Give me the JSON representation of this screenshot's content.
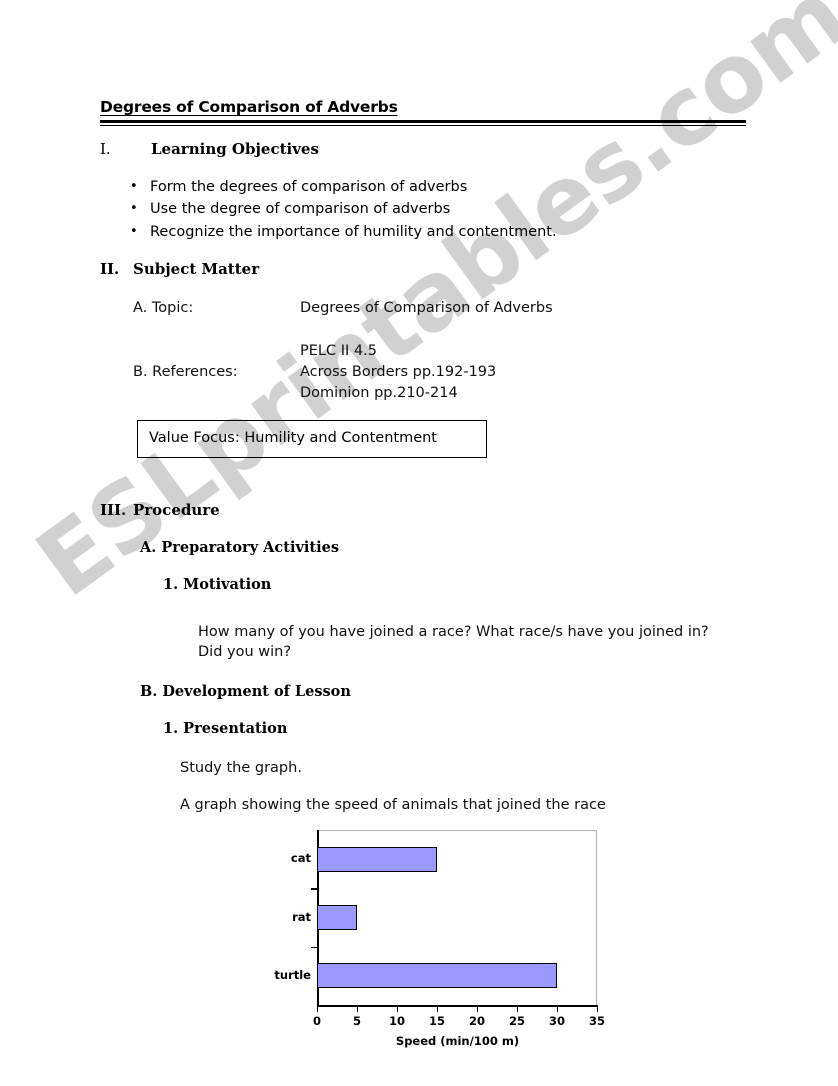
{
  "watermark": {
    "text": "ESLprintables.com",
    "color": "#c9c9c9"
  },
  "document": {
    "title": "Degrees of Comparison of Adverbs"
  },
  "sections": {
    "learning_objectives": {
      "numeral": "I.",
      "heading": "Learning Objectives",
      "items": [
        "Form the degrees of comparison of adverbs",
        "Use the degree of comparison of adverbs",
        "Recognize the importance of humility and contentment."
      ]
    },
    "subject_matter": {
      "numeral": "II.",
      "heading": "Subject Matter",
      "topic_label": "A. Topic:",
      "topic_value": "Degrees of Comparison of Adverbs",
      "references_label": "B. References:",
      "references": [
        "PELC II 4.5",
        "Across Borders pp.192-193",
        "Dominion pp.210-214"
      ],
      "value_focus": "Value Focus: Humility and Contentment"
    },
    "procedure": {
      "numeral": "III.",
      "heading": "Procedure",
      "sub_a": {
        "heading": "A. Preparatory Activities",
        "item_1": "1. Motivation",
        "motivation_line_1": "How many of you have joined a race?  What race/s have you joined in?",
        "motivation_line_2": "Did you win?"
      },
      "sub_b": {
        "heading": "B. Development of Lesson",
        "item_1": "1. Presentation",
        "study_line": "Study the graph.",
        "graph_caption": "A graph showing the speed of animals that joined the race"
      }
    }
  },
  "chart_data": {
    "type": "bar",
    "orientation": "horizontal",
    "title": "",
    "categories": [
      "cat",
      "rat",
      "turtle"
    ],
    "values": [
      15,
      5,
      30
    ],
    "xlabel": "Speed (min/100 m)",
    "ylabel": "",
    "xlim": [
      0,
      35
    ],
    "xticks": [
      0,
      5,
      10,
      15,
      20,
      25,
      30,
      35
    ],
    "grid": false,
    "legend": false,
    "bar_color": "#9999ff",
    "bar_border_color": "#000000"
  }
}
